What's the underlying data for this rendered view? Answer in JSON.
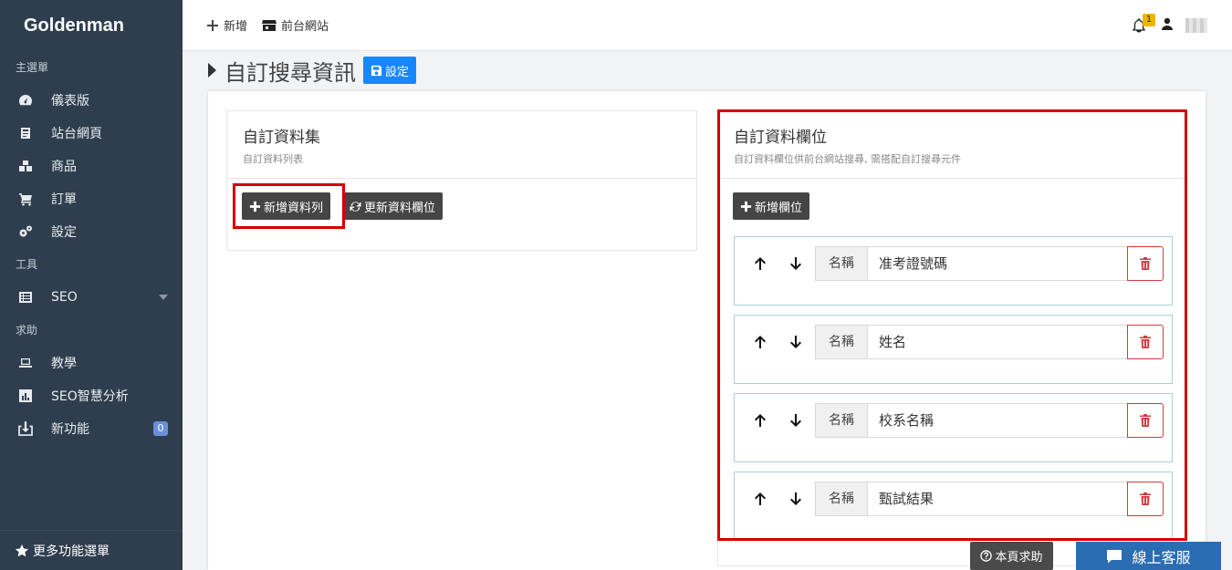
{
  "app": {
    "brand": "Goldenman"
  },
  "sidebar": {
    "section_main": "主選單",
    "section_tools": "工具",
    "section_help": "求助",
    "items": [
      {
        "label": "儀表版",
        "icon": "dashboard-icon"
      },
      {
        "label": "站台網頁",
        "icon": "page-icon"
      },
      {
        "label": "商品",
        "icon": "boxes-icon"
      },
      {
        "label": "訂單",
        "icon": "cart-icon"
      },
      {
        "label": "設定",
        "icon": "gears-icon"
      },
      {
        "label": "SEO",
        "icon": "list-icon"
      },
      {
        "label": "教學",
        "icon": "laptop-icon"
      },
      {
        "label": "SEO智慧分析",
        "icon": "chart-icon"
      },
      {
        "label": "新功能",
        "icon": "download-icon",
        "badge": "0"
      }
    ],
    "more_menu": "更多功能選單"
  },
  "topbar": {
    "add_label": "新增",
    "front_site_label": "前台網站",
    "notification_count": "1"
  },
  "page": {
    "title": "自訂搜尋資訊",
    "save_button": "設定"
  },
  "left_card": {
    "title": "自訂資料集",
    "subtitle": "自訂資料列表",
    "add_row_button": "新增資料列",
    "refresh_button": "更新資料欄位"
  },
  "right_card": {
    "title": "自訂資料欄位",
    "subtitle": "自訂資料欄位供前台網站搜尋, 需搭配自訂搜尋元件",
    "add_field_button": "新增欄位",
    "fields": [
      {
        "label": "名稱",
        "value": "准考證號碼"
      },
      {
        "label": "名稱",
        "value": "姓名"
      },
      {
        "label": "名稱",
        "value": "校系名稱"
      },
      {
        "label": "名稱",
        "value": "甄試結果"
      }
    ]
  },
  "footer": {
    "help_button": "本頁求助",
    "chat_button": "線上客服"
  },
  "colors": {
    "sidebar_bg": "#2f3e4e",
    "primary": "#1787ff",
    "highlight": "#d40000",
    "dark_button": "#454545",
    "chat": "#2a6db3"
  }
}
